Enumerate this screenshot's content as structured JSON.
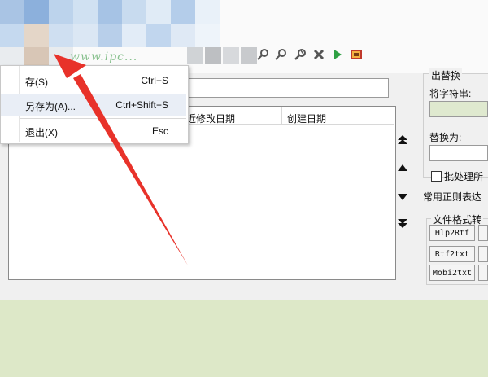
{
  "menu": {
    "items": [
      {
        "label": "保存(S)",
        "display_label": "存(S)",
        "shortcut": "Ctrl+S"
      },
      {
        "label": "另存为(A)...",
        "shortcut": "Ctrl+Shift+S"
      },
      {
        "label": "退出(X)",
        "shortcut": "Esc"
      }
    ]
  },
  "toolbar": {
    "icons": [
      "search-icon",
      "search-icon",
      "settings-icon",
      "delete-icon",
      "play-icon",
      "image-icon"
    ],
    "watermark_text": "www.ipc..."
  },
  "file_list": {
    "columns": [
      "最近修改日期",
      "创建日期"
    ],
    "col1_visible": "近修改日期",
    "col2": "创建日期"
  },
  "nav": {
    "buttons": [
      "move-top",
      "move-up",
      "move-down",
      "move-bottom"
    ]
  },
  "right_panel": {
    "group_title": "出替换",
    "find_label": "将字符串:",
    "replace_label": "替换为:",
    "batch_checkbox_label": "批处理所",
    "regex_label": "常用正则表达",
    "format_group": "文件格式转",
    "format_buttons": [
      "Hlp2Rtf",
      "Rtf2txt",
      "Mobi2txt"
    ]
  },
  "colors": {
    "status_bar": "#dde8c8",
    "input_highlight": "#dfe9cf",
    "arrow": "#e8322a"
  }
}
